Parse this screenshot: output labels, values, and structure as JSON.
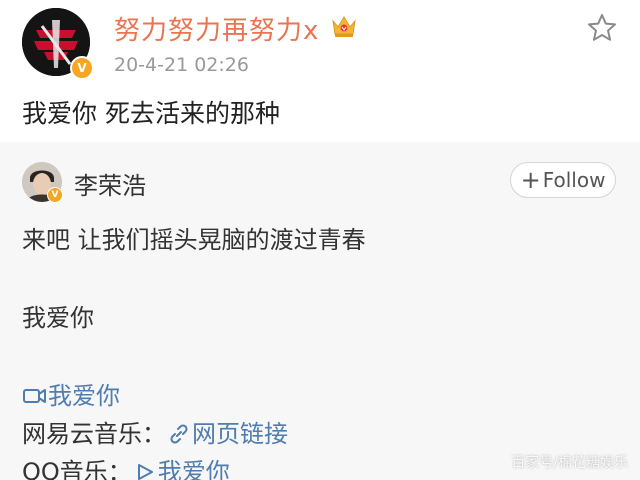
{
  "post": {
    "author_name": "努力努力再努力x",
    "time": "20-4-21 02:26",
    "text": "我爱你 死去活来的那种",
    "verified_mark": "V",
    "avatar_icon": "team-logo-avatar",
    "crown_icon": "crown-icon",
    "favorite_icon": "star-outline-icon"
  },
  "repost": {
    "author_name": "李荣浩",
    "verified_mark": "V",
    "follow_label": "Follow",
    "follow_plus": "+",
    "line1": "来吧 让我们摇头晃脑的渡过青春",
    "line2": "我爱你",
    "video_link": "我爱你",
    "netease_label": "网易云音乐：",
    "netease_link": "网页链接",
    "qq_label": "QQ音乐：",
    "qq_link": "我爱你"
  },
  "watermark": "百家号/棉花糖娱乐",
  "colors": {
    "accent_name": "#eb7350",
    "link": "#507daf",
    "verified": "#f6a623",
    "card_bg": "#f7f7f7"
  }
}
